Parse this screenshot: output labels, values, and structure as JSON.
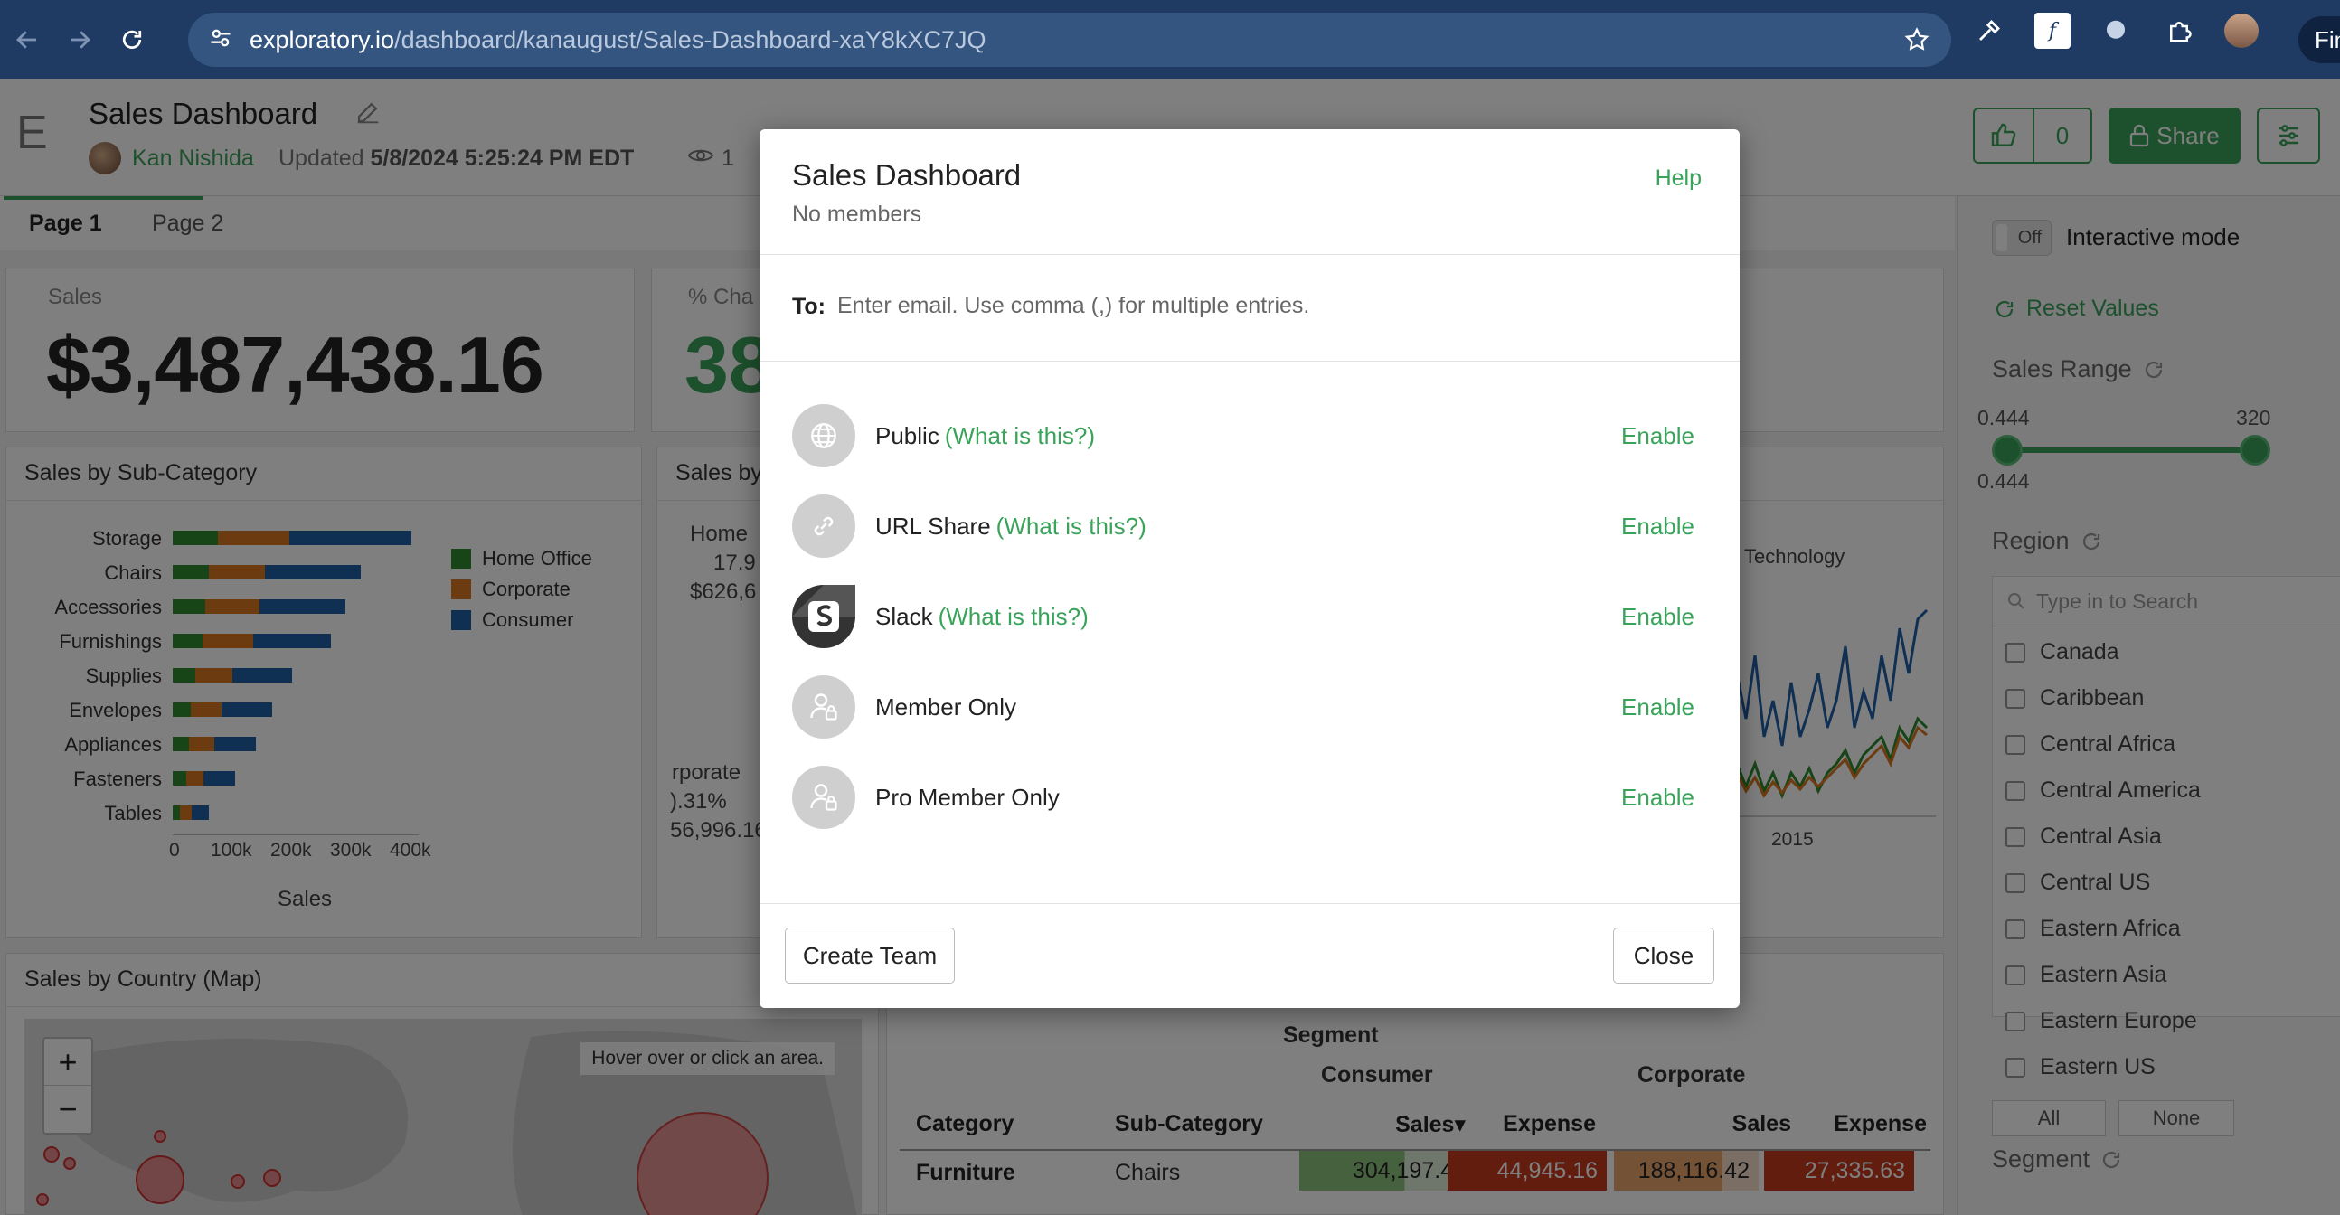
{
  "browser": {
    "url_host": "exploratory.io",
    "url_path": "/dashboard/kanaugust/Sales-Dashboard-xaY8kXC7JQ",
    "fin_label": "Fin"
  },
  "header": {
    "logo": "E",
    "title": "Sales Dashboard",
    "author": "Kan Nishida",
    "updated_label": "Updated",
    "updated_value": "5/8/2024 5:25:24 PM EDT",
    "views": "1",
    "likes": "0",
    "share_label": "Share"
  },
  "tabs": [
    {
      "label": "Page 1",
      "active": true
    },
    {
      "label": "Page 2",
      "active": false
    }
  ],
  "kpi_sales": {
    "label": "Sales",
    "value": "$3,487,438.16"
  },
  "kpi_change": {
    "label": "% Cha",
    "value": "38"
  },
  "subcategory_card": {
    "title": "Sales by Sub-Category",
    "xlabel": "Sales"
  },
  "chart_data": {
    "type": "bar",
    "orientation": "horizontal",
    "stacked": true,
    "title": "Sales by Sub-Category",
    "xlabel": "Sales",
    "ylabel": "",
    "categories": [
      "Storage",
      "Chairs",
      "Accessories",
      "Furnishings",
      "Supplies",
      "Envelopes",
      "Appliances",
      "Fasteners",
      "Tables"
    ],
    "series": [
      {
        "name": "Home Office",
        "color": "#2e8b2e",
        "values": [
          75000,
          60000,
          55000,
          50000,
          38000,
          30000,
          28000,
          22000,
          12000
        ]
      },
      {
        "name": "Corporate",
        "color": "#d9771e",
        "values": [
          120000,
          95000,
          90000,
          85000,
          62000,
          52000,
          42000,
          30000,
          20000
        ]
      },
      {
        "name": "Consumer",
        "color": "#1f5fa6",
        "values": [
          205000,
          160000,
          145000,
          130000,
          100000,
          85000,
          70000,
          52000,
          28000
        ]
      }
    ],
    "xticks": [
      "0",
      "100k",
      "200k",
      "300k",
      "400k"
    ],
    "xlim": [
      0,
      400000
    ],
    "legend_position": "right"
  },
  "segment_card": {
    "title": "Sales by",
    "home": "Home",
    "home_pct": "17.9",
    "home_val": "$626,6",
    "corp": "rporate",
    "corp_pct": ").31%",
    "corp_val": "56,996.16"
  },
  "trend_card": {
    "legend": "Technology",
    "xtick": "2015"
  },
  "map_card": {
    "title": "Sales by Country (Map)",
    "tip": "Hover over or click an area.",
    "zoom_in": "+",
    "zoom_out": "−"
  },
  "pivot": {
    "segment_label": "Segment",
    "groups": [
      "Consumer",
      "Corporate"
    ],
    "columns": [
      "Category",
      "Sub-Category",
      "Sales▾",
      "Expense",
      "Sales",
      "Expense"
    ],
    "row": {
      "category": "Furniture",
      "subcategory": "Chairs",
      "values": [
        "304,197.48",
        "44,945.16",
        "188,116.42",
        "27,335.63"
      ]
    }
  },
  "rpanel": {
    "toggle": "Off",
    "interactive_label": "Interactive mode",
    "reset_label": "Reset Values",
    "sales_range_label": "Sales Range",
    "range_min": "0.444",
    "range_max": "320",
    "range_current": "0.444",
    "region_label": "Region",
    "search_placeholder": "Type in to Search",
    "regions": [
      "Canada",
      "Caribbean",
      "Central Africa",
      "Central America",
      "Central Asia",
      "Central US",
      "Eastern Africa",
      "Eastern Asia",
      "Eastern Europe",
      "Eastern US"
    ],
    "all_label": "All",
    "none_label": "None",
    "segment_label": "Segment"
  },
  "modal": {
    "title": "Sales Dashboard",
    "subtitle": "No members",
    "help": "Help",
    "to_label": "To:",
    "email_placeholder": "Enter email. Use comma (,) for multiple entries.",
    "options": [
      {
        "label": "Public",
        "what": "(What is this?)",
        "enable": "Enable",
        "icon": "globe-icon"
      },
      {
        "label": "URL Share",
        "what": "(What is this?)",
        "enable": "Enable",
        "icon": "link-icon"
      },
      {
        "label": "Slack",
        "what": "(What is this?)",
        "enable": "Enable",
        "icon": "slack-icon"
      },
      {
        "label": "Member Only",
        "what": "",
        "enable": "Enable",
        "icon": "member-lock-icon"
      },
      {
        "label": "Pro Member Only",
        "what": "",
        "enable": "Enable",
        "icon": "member-lock-icon"
      }
    ],
    "create_team": "Create Team",
    "close": "Close"
  },
  "colors": {
    "accent": "#3aa35a",
    "chrome": "#1f3b64"
  }
}
